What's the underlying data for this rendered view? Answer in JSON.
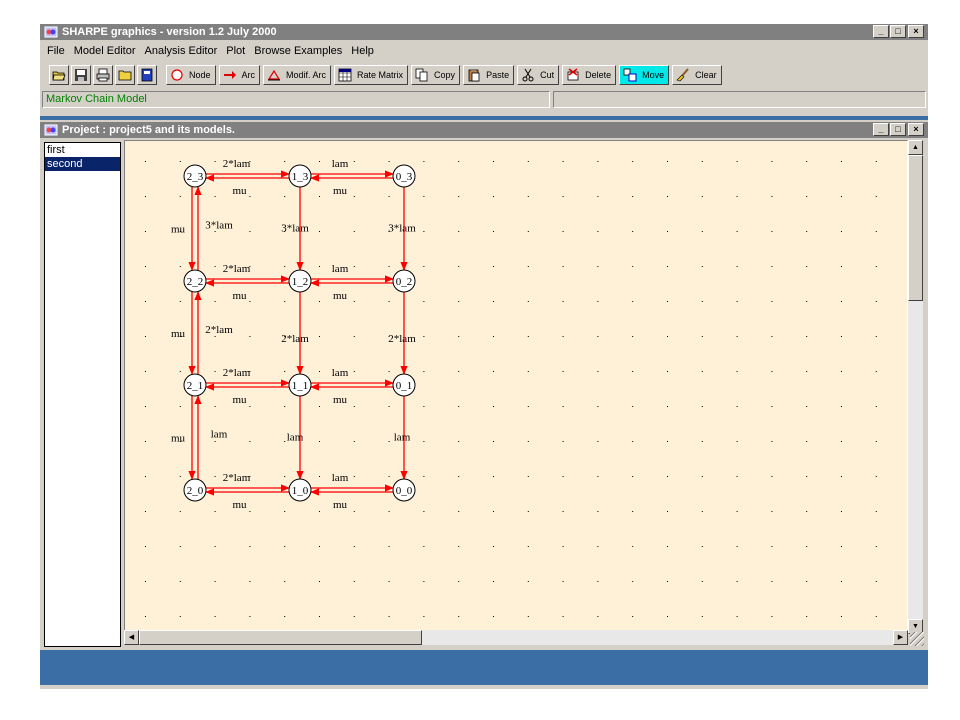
{
  "app": {
    "title": "SHARPE graphics  -  version 1.2  July 2000",
    "menu": [
      "File",
      "Model Editor",
      "Analysis Editor",
      "Plot",
      "Browse Examples",
      "Help"
    ],
    "toolbar": {
      "node": "Node",
      "arc": "Arc",
      "modif_arc": "Modif. Arc",
      "rate_matrix": "Rate Matrix",
      "copy": "Copy",
      "paste": "Paste",
      "cut": "Cut",
      "delete": "Delete",
      "move": "Move",
      "clear": "Clear"
    },
    "status": "Markov Chain Model",
    "window_buttons": {
      "minimize": "_",
      "maximize": "□",
      "close": "×"
    }
  },
  "project": {
    "title": "Project : project5 and its models.",
    "models": [
      {
        "label": "first",
        "selected": false
      },
      {
        "label": "second",
        "selected": true
      }
    ]
  },
  "graph": {
    "nodes": [
      {
        "id": "2_3",
        "label": "2_3",
        "col": 0,
        "row": 0
      },
      {
        "id": "1_3",
        "label": "1_3",
        "col": 1,
        "row": 0
      },
      {
        "id": "0_3",
        "label": "0_3",
        "col": 2,
        "row": 0
      },
      {
        "id": "2_2",
        "label": "2_2",
        "col": 0,
        "row": 1
      },
      {
        "id": "1_2",
        "label": "1_2",
        "col": 1,
        "row": 1
      },
      {
        "id": "0_2",
        "label": "0_2",
        "col": 2,
        "row": 1
      },
      {
        "id": "2_1",
        "label": "2_1",
        "col": 0,
        "row": 2
      },
      {
        "id": "1_1",
        "label": "1_1",
        "col": 1,
        "row": 2
      },
      {
        "id": "0_1",
        "label": "0_1",
        "col": 2,
        "row": 2
      },
      {
        "id": "2_0",
        "label": "2_0",
        "col": 0,
        "row": 3
      },
      {
        "id": "1_0",
        "label": "1_0",
        "col": 1,
        "row": 3
      },
      {
        "id": "0_0",
        "label": "0_0",
        "col": 2,
        "row": 3
      }
    ],
    "rows": [
      {
        "right_labels": [
          "2*lam",
          "lam"
        ],
        "left_labels": [
          "mu",
          "mu"
        ]
      },
      {
        "right_labels": [
          "2*lam",
          "lam"
        ],
        "left_labels": [
          "mu",
          "mu"
        ]
      },
      {
        "right_labels": [
          "2*lam",
          "lam"
        ],
        "left_labels": [
          "mu",
          "mu"
        ]
      },
      {
        "right_labels": [
          "2*lam",
          "lam"
        ],
        "left_labels": [
          "mu",
          "mu"
        ]
      }
    ],
    "cols": [
      {
        "down_labels": [
          "3*lam",
          "2*lam",
          "lam"
        ],
        "up_labels": [
          "mu",
          "mu",
          "mu"
        ]
      },
      {
        "down_labels": [
          "3*lam",
          "2*lam",
          "lam"
        ]
      },
      {
        "down_labels": [
          "3*lam",
          "2*lam",
          "lam"
        ]
      }
    ],
    "colors": {
      "arc": "#ff0000",
      "canvas": "#fff0d8",
      "node": "#ffffff"
    }
  }
}
